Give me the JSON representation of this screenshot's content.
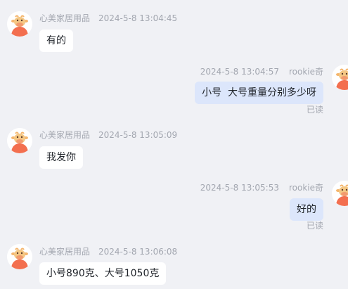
{
  "messages": [
    {
      "side": "left",
      "sender": "心美家居用品",
      "time": "2024-5-8 13:04:45",
      "text": "有的"
    },
    {
      "side": "right",
      "sender": "rookie奇",
      "time": "2024-5-8 13:04:57",
      "text": "小号  大号重量分别多少呀",
      "status": "已读"
    },
    {
      "side": "left",
      "sender": "心美家居用品",
      "time": "2024-5-8 13:05:09",
      "text": "我发你"
    },
    {
      "side": "right",
      "sender": "rookie奇",
      "time": "2024-5-8 13:05:53",
      "text": "好的",
      "status": "已读"
    },
    {
      "side": "left",
      "sender": "心美家居用品",
      "time": "2024-5-8 13:06:08",
      "text": "小号890克、大号1050克"
    }
  ],
  "colors": {
    "background": "#f0f1f5",
    "bubble_left": "#ffffff",
    "bubble_right": "#dce6fb",
    "meta_text": "#a3a7b0",
    "avatar_accent": "#f36f4f"
  },
  "icons": {
    "avatar": "cow-avatar-icon"
  }
}
